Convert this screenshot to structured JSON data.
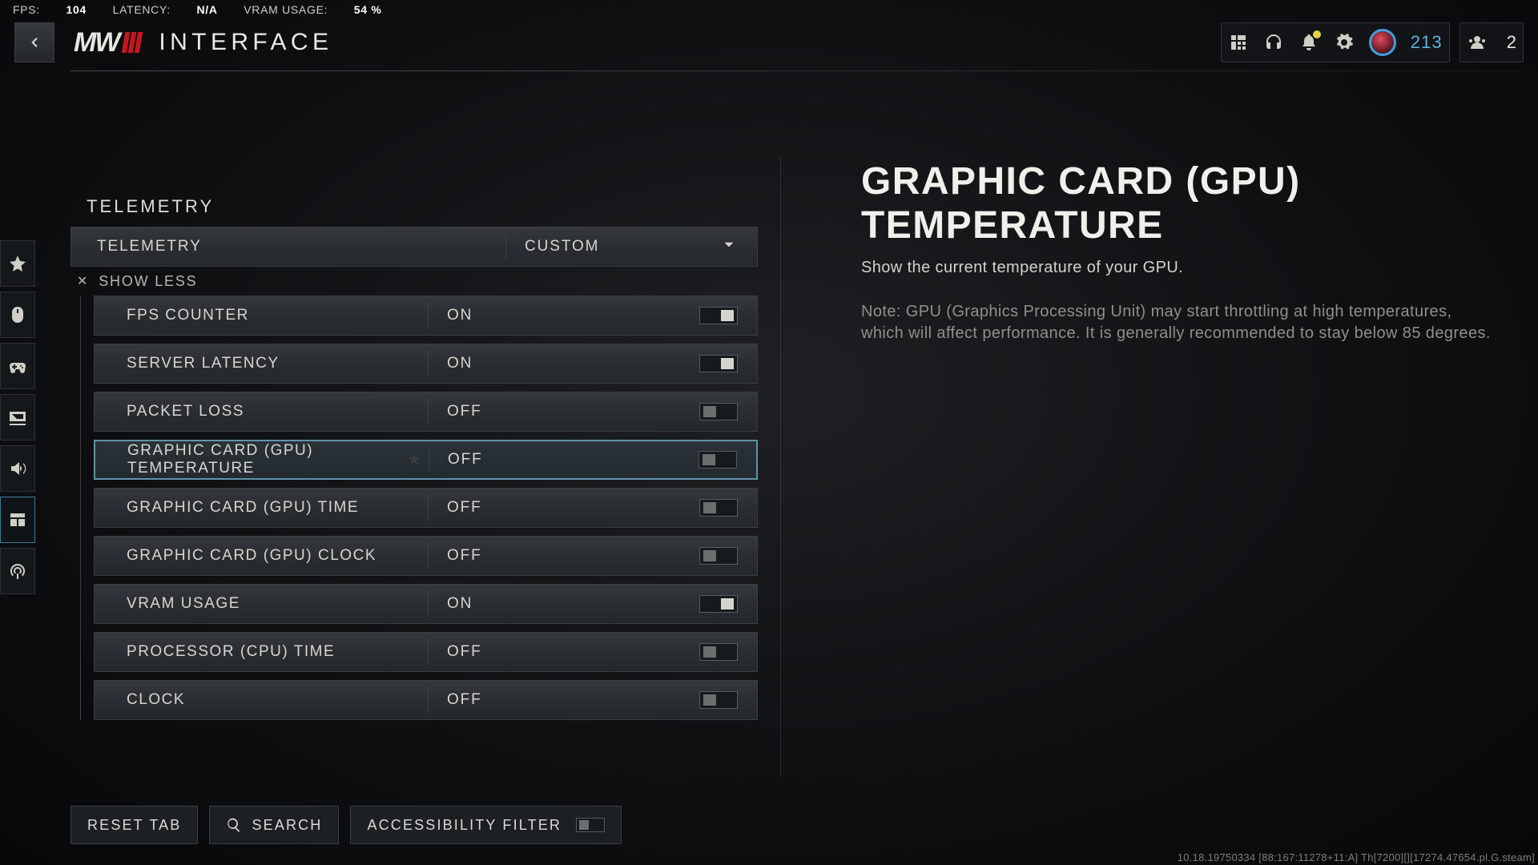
{
  "telemetry_bar": {
    "fps_label": "FPS:",
    "fps_value": "104",
    "latency_label": "LATENCY:",
    "latency_value": "N/A",
    "vram_label": "VRAM USAGE:",
    "vram_value": "54 %"
  },
  "header": {
    "logo_text": "MW",
    "page_title": "INTERFACE",
    "level": "213",
    "party_count": "2"
  },
  "section": {
    "label": "TELEMETRY",
    "dropdown_label": "TELEMETRY",
    "dropdown_value": "CUSTOM",
    "show_less": "SHOW LESS"
  },
  "options": [
    {
      "label": "FPS COUNTER",
      "value": "ON",
      "on": true,
      "selected": false
    },
    {
      "label": "SERVER LATENCY",
      "value": "ON",
      "on": true,
      "selected": false
    },
    {
      "label": "PACKET LOSS",
      "value": "OFF",
      "on": false,
      "selected": false
    },
    {
      "label": "GRAPHIC CARD (GPU) TEMPERATURE",
      "value": "OFF",
      "on": false,
      "selected": true
    },
    {
      "label": "GRAPHIC CARD (GPU) TIME",
      "value": "OFF",
      "on": false,
      "selected": false
    },
    {
      "label": "GRAPHIC CARD (GPU) CLOCK",
      "value": "OFF",
      "on": false,
      "selected": false
    },
    {
      "label": "VRAM USAGE",
      "value": "ON",
      "on": true,
      "selected": false
    },
    {
      "label": "PROCESSOR (CPU) TIME",
      "value": "OFF",
      "on": false,
      "selected": false
    },
    {
      "label": "CLOCK",
      "value": "OFF",
      "on": false,
      "selected": false
    }
  ],
  "detail": {
    "title": "GRAPHIC CARD (GPU) TEMPERATURE",
    "subtitle": "Show the current temperature of your GPU.",
    "note": "Note: GPU (Graphics Processing Unit) may start throttling at high temperatures, which will affect performance. It is generally recommended to stay below 85 degrees."
  },
  "footer": {
    "reset": "RESET TAB",
    "search": "SEARCH",
    "a11y": "ACCESSIBILITY FILTER"
  },
  "build": "10.18.19750334 [88:167:11278+11:A] Th[7200][][17274.47654.pl.G.steam]"
}
